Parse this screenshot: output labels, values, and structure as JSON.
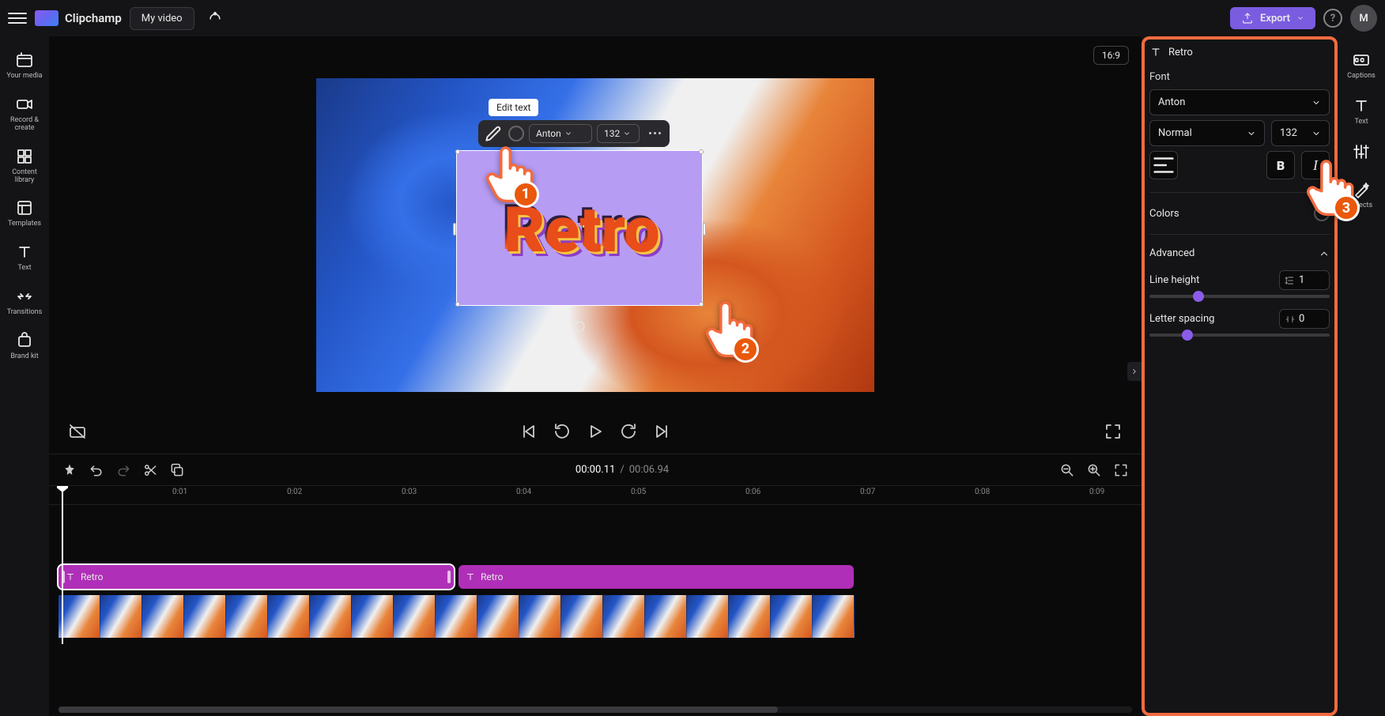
{
  "header": {
    "brand": "Clipchamp",
    "project_name": "My video",
    "export_label": "Export",
    "avatar_initial": "M"
  },
  "sidebar_left": {
    "items": [
      {
        "label": "Your media"
      },
      {
        "label": "Record & create"
      },
      {
        "label": "Content library"
      },
      {
        "label": "Templates"
      },
      {
        "label": "Text"
      },
      {
        "label": "Transitions"
      },
      {
        "label": "Brand kit"
      }
    ]
  },
  "preview": {
    "aspect_ratio": "16:9",
    "tooltip": "Edit text",
    "text_content": "Retro",
    "float_toolbar": {
      "font": "Anton",
      "size": "132"
    }
  },
  "hands": {
    "h1": "1",
    "h2": "2",
    "h3": "3"
  },
  "playback": {
    "current_time": "00:00.11",
    "separator": "/",
    "duration": "00:06.94"
  },
  "timeline": {
    "ticks": [
      "0:01",
      "0:02",
      "0:03",
      "0:04",
      "0:05",
      "0:06",
      "0:07",
      "0:08",
      "0:09"
    ],
    "clips": [
      {
        "label": "Retro",
        "selected": true
      },
      {
        "label": "Retro",
        "selected": false
      }
    ]
  },
  "right_panel": {
    "title": "Retro",
    "font_section_label": "Font",
    "font_family": "Anton",
    "font_weight": "Normal",
    "font_size": "132",
    "colors_label": "Colors",
    "advanced_label": "Advanced",
    "line_height_label": "Line height",
    "line_height_value": "1",
    "letter_spacing_label": "Letter spacing",
    "letter_spacing_value": "0"
  },
  "sidebar_far": {
    "items": [
      {
        "label": "Captions"
      },
      {
        "label": "Text"
      },
      {
        "label": ""
      },
      {
        "label": "Effects"
      }
    ]
  },
  "colors": {
    "accent": "#7a5ce0",
    "highlight": "#f36b3f",
    "clip": "#b02fb8"
  }
}
